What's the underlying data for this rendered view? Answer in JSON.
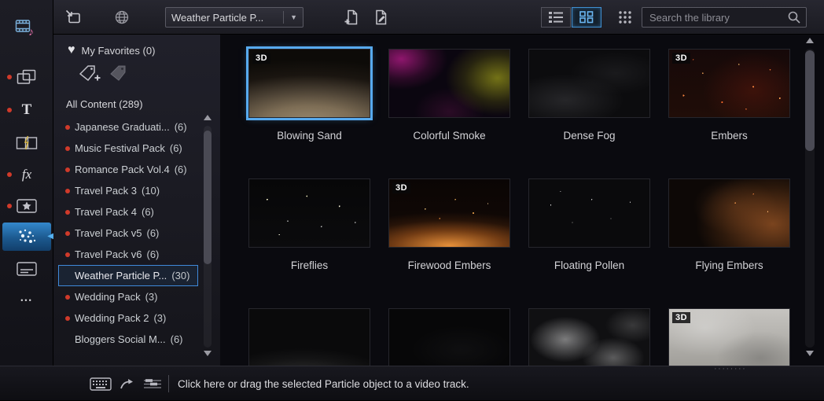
{
  "toolbar": {
    "category_dropdown_value": "Weather Particle P...",
    "search_placeholder": "Search the library"
  },
  "icons": {
    "chevron_down": "▼",
    "heart": "♥",
    "collapse_left": "◀",
    "selected_room_marker": "◀",
    "grip_dots": "········"
  },
  "sidebar": {
    "title_glyph": "T",
    "effect_glyph": "fx",
    "more_glyph": "•••"
  },
  "library_tree": {
    "favorites_label": "My Favorites (0)",
    "all_content_label": "All Content (289)",
    "items": [
      {
        "label": "Japanese Graduati...",
        "count": "(6)"
      },
      {
        "label": "Music Festival Pack",
        "count": "(6)"
      },
      {
        "label": "Romance Pack Vol.4",
        "count": "(6)"
      },
      {
        "label": "Travel Pack 3",
        "count": "(10)"
      },
      {
        "label": "Travel Pack 4",
        "count": "(6)"
      },
      {
        "label": "Travel Pack v5",
        "count": "(6)"
      },
      {
        "label": "Travel Pack v6",
        "count": "(6)"
      },
      {
        "label": "Weather Particle P...",
        "count": "(30)"
      },
      {
        "label": "Wedding Pack",
        "count": "(3)"
      },
      {
        "label": "Wedding Pack 2",
        "count": "(3)"
      },
      {
        "label": "Bloggers Social M...",
        "count": "(6)"
      }
    ]
  },
  "grid": {
    "items": [
      {
        "label": "Blowing Sand",
        "badge": "3D"
      },
      {
        "label": "Colorful Smoke",
        "badge": ""
      },
      {
        "label": "Dense Fog",
        "badge": ""
      },
      {
        "label": "Embers",
        "badge": "3D"
      },
      {
        "label": "Fireflies",
        "badge": ""
      },
      {
        "label": "Firewood Embers",
        "badge": "3D"
      },
      {
        "label": "Floating Pollen",
        "badge": ""
      },
      {
        "label": "Flying Embers",
        "badge": ""
      },
      {
        "label": "",
        "badge": ""
      },
      {
        "label": "",
        "badge": ""
      },
      {
        "label": "",
        "badge": ""
      },
      {
        "label": "",
        "badge": "3D"
      }
    ]
  },
  "status_bar": {
    "hint": "Click here or drag the selected Particle object to a video track."
  }
}
